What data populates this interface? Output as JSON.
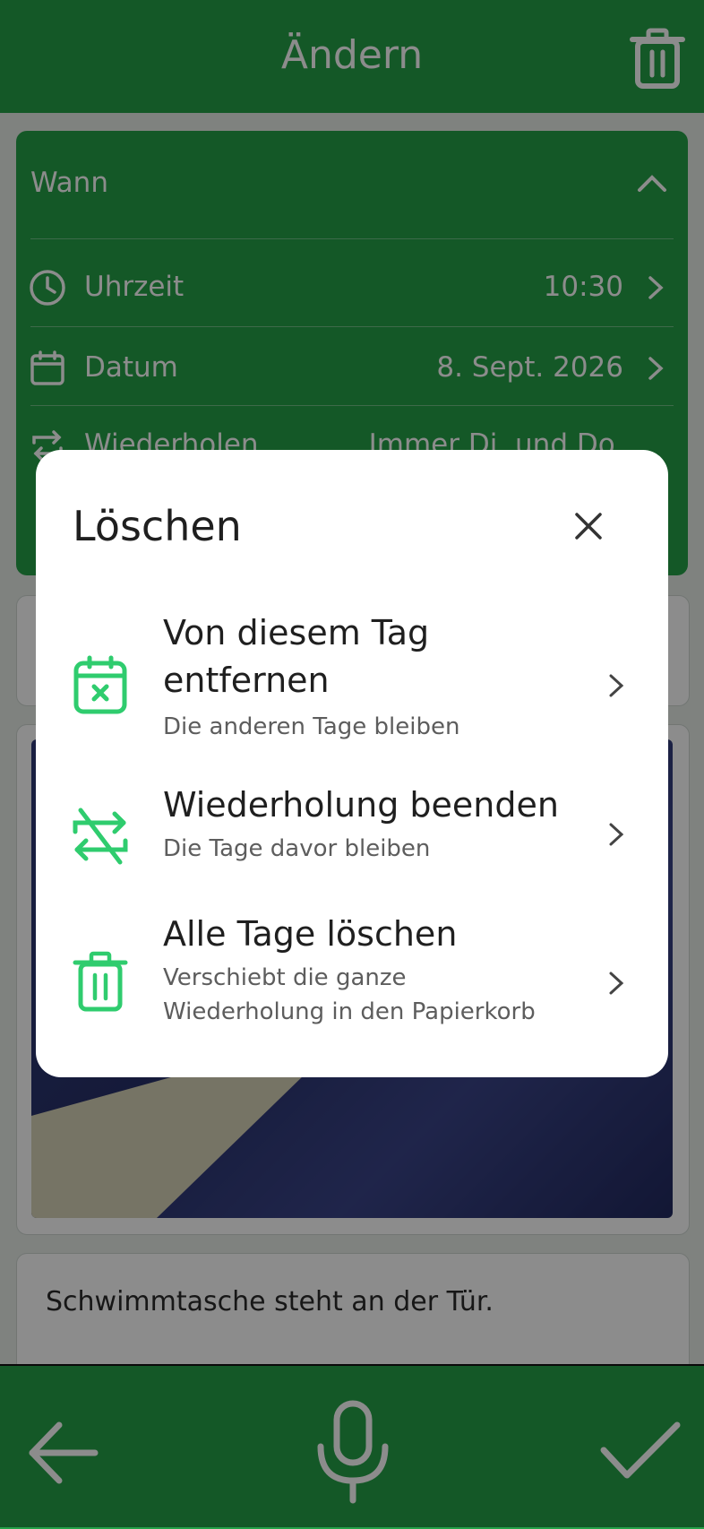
{
  "header": {
    "title": "Ändern"
  },
  "wann": {
    "title": "Wann",
    "rows": [
      {
        "label": "Uhrzeit",
        "value": "10:30"
      },
      {
        "label": "Datum",
        "value": "8. Sept. 2026"
      },
      {
        "label": "Wiederholen",
        "value": "Immer Di. und Do."
      }
    ]
  },
  "note": {
    "text": "Schwimmtasche steht an der Tür."
  },
  "dialog": {
    "title": "Löschen",
    "options": [
      {
        "title_line1": "Von diesem Tag",
        "title_line2": "entfernen",
        "subtitle": "Die anderen Tage bleiben",
        "icon": "calendar-x-icon"
      },
      {
        "title_line1": "Wiederholung beenden",
        "subtitle": "Die Tage davor bleiben",
        "icon": "repeat-off-icon"
      },
      {
        "title_line1": "Alle Tage löschen",
        "subtitle_line1": "Verschiebt die ganze",
        "subtitle_line2": "Wiederholung in den Papierkorb",
        "icon": "trash-icon"
      }
    ]
  },
  "colors": {
    "accent": "#25a148",
    "icon_green": "#2fcc6e",
    "dialog_bg": "#ffffff"
  }
}
